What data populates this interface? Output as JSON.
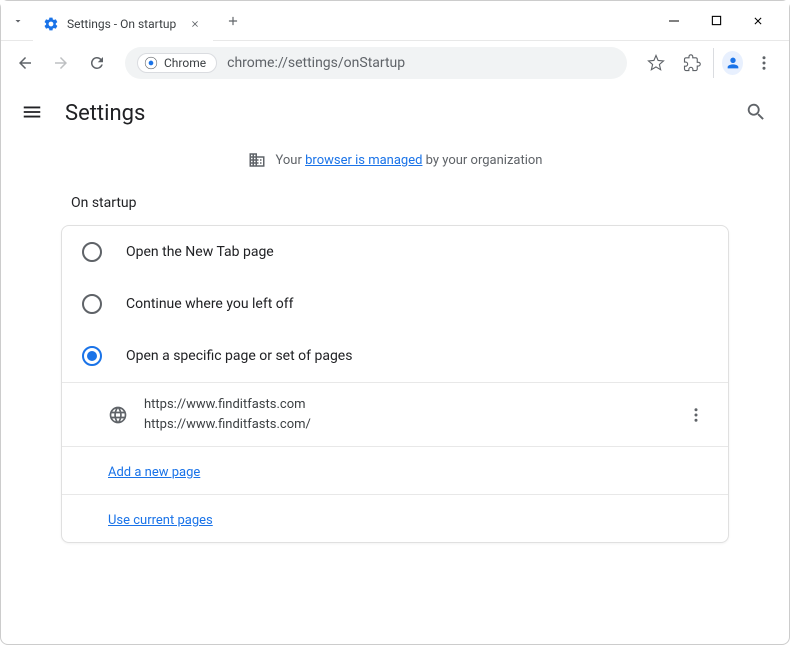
{
  "tab": {
    "title": "Settings - On startup"
  },
  "addressbar": {
    "chip_label": "Chrome",
    "url": "chrome://settings/onStartup"
  },
  "header": {
    "title": "Settings"
  },
  "managed": {
    "prefix": "Your ",
    "link": "browser is managed",
    "suffix": " by your organization"
  },
  "section": {
    "title": "On startup"
  },
  "options": {
    "new_tab": "Open the New Tab page",
    "continue": "Continue where you left off",
    "specific": "Open a specific page or set of pages"
  },
  "startup_page": {
    "display": "https://www.finditfasts.com",
    "full_url": "https://www.finditfasts.com/"
  },
  "actions": {
    "add_page": "Add a new page",
    "use_current": "Use current pages"
  }
}
